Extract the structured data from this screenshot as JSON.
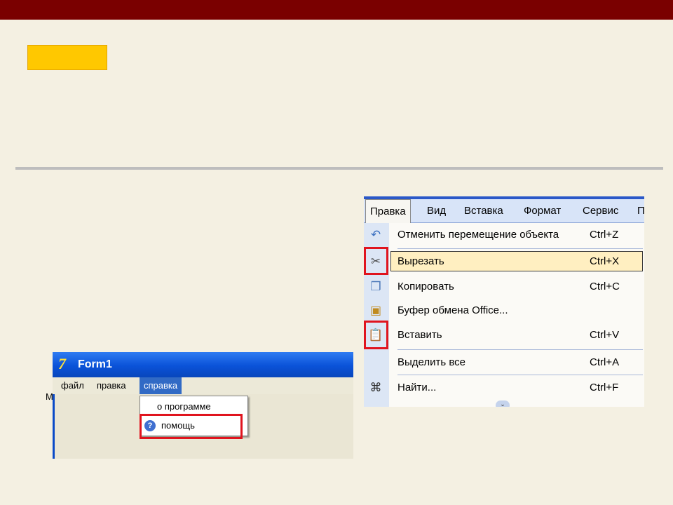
{
  "colors": {
    "top_bar": "#7A0000",
    "tag": "#FFC800",
    "highlight": "#E0141E"
  },
  "office_menu": {
    "menubar": [
      {
        "label": "Правка"
      },
      {
        "label": "Вид"
      },
      {
        "label": "Вставка"
      },
      {
        "label": "Формат"
      },
      {
        "label": "Сервис"
      },
      {
        "label": "П"
      }
    ],
    "items": [
      {
        "label": "Отменить перемещение объекта",
        "shortcut": "Ctrl+Z",
        "icon": "undo-icon"
      },
      {
        "label": "Вырезать",
        "shortcut": "Ctrl+X",
        "icon": "scissors-icon",
        "highlighted": true
      },
      {
        "label": "Копировать",
        "shortcut": "Ctrl+C",
        "icon": "copy-icon"
      },
      {
        "label": "Буфер обмена Office...",
        "shortcut": "",
        "icon": "clipboard-office-icon"
      },
      {
        "label": "Вставить",
        "shortcut": "Ctrl+V",
        "icon": "paste-icon"
      },
      {
        "label": "Выделить все",
        "shortcut": "Ctrl+A",
        "icon": ""
      },
      {
        "label": "Найти...",
        "shortcut": "Ctrl+F",
        "icon": "binoculars-icon"
      }
    ]
  },
  "form1": {
    "title": "Form1",
    "menu": [
      {
        "label": "файл"
      },
      {
        "label": "правка"
      },
      {
        "label": "справка"
      }
    ],
    "stray_char": "М",
    "popup": [
      {
        "label": "о программе"
      },
      {
        "label": "помощь",
        "icon": "help-icon"
      }
    ]
  }
}
